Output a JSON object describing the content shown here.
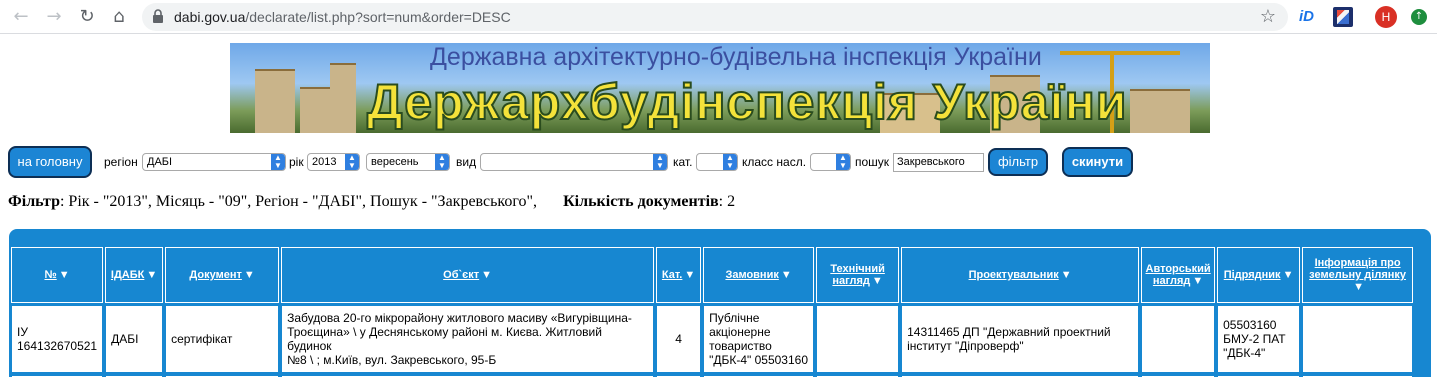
{
  "browser": {
    "url_host": "dabi.gov.ua",
    "url_path": "/declarate/list.php?sort=num&order=DESC",
    "avatar_letter": "H",
    "ext_id_label": "iD"
  },
  "banner": {
    "subtitle": "Державна архітектурно-будівельна інспекція України",
    "title": "Держархбудінспекція України"
  },
  "filters": {
    "home_button": "на головну",
    "region_label": "регіон",
    "region_value": "ДАБІ",
    "year_label": "рік",
    "year_value": "2013",
    "month_value": "вересень",
    "kind_label": "вид",
    "kind_value": "",
    "cat_label": "кат.",
    "cat_value": "",
    "class_label": "класс насл.",
    "class_value": "",
    "search_label": "пошук",
    "search_value": "Закревського",
    "filter_button": "фільтр",
    "reset_button": "скинути"
  },
  "summary": {
    "filter_label": "Фільтр",
    "filter_text": ": Рік - \"2013\", Місяць - \"09\", Регіон - \"ДАБІ\", Пошук - \"Закревського\",",
    "count_label": "Кількість документів",
    "count_text": ": 2"
  },
  "table": {
    "headers": {
      "num": "№",
      "idabk": "ІДАБК",
      "document": "Документ",
      "object": "Об`єкт",
      "cat": "Кат.",
      "customer": "Замовник",
      "tech_supervision_1": "Технічний",
      "tech_supervision_2": "нагляд",
      "designer": "Проектувальник",
      "author_supervision_1": "Авторський",
      "author_supervision_2": "нагляд",
      "contractor": "Підрядник",
      "land_info_1": "Інформація про",
      "land_info_2": "земельну ділянку"
    },
    "sort_marker": "▼",
    "rows": [
      {
        "num_1": "ІУ",
        "num_2": "164132670521",
        "idabk": "ДАБІ",
        "document": "сертифікат",
        "object_1": "Забудова 20-го мікрорайону житлового масиву «Вигурівщина-",
        "object_2": "Троєщина» \\ у Деснянському районі м. Києва. Житловий будинок",
        "object_3": "№8 \\ ; м.Київ, вул. Закревського, 95-Б",
        "cat": "4",
        "customer_1": "Публічне",
        "customer_2": "акціонерне",
        "customer_3": "товариство",
        "customer_4": "\"ДБК-4\" 05503160",
        "tech_supervision": "",
        "designer_1": "14311465 ДП \"Державний проектний",
        "designer_2": "інститут \"Діпроверф\"",
        "author_supervision": "",
        "contractor_1": "05503160",
        "contractor_2": "БМУ-2 ПАТ",
        "contractor_3": "\"ДБК-4\"",
        "land_info": ""
      }
    ]
  }
}
